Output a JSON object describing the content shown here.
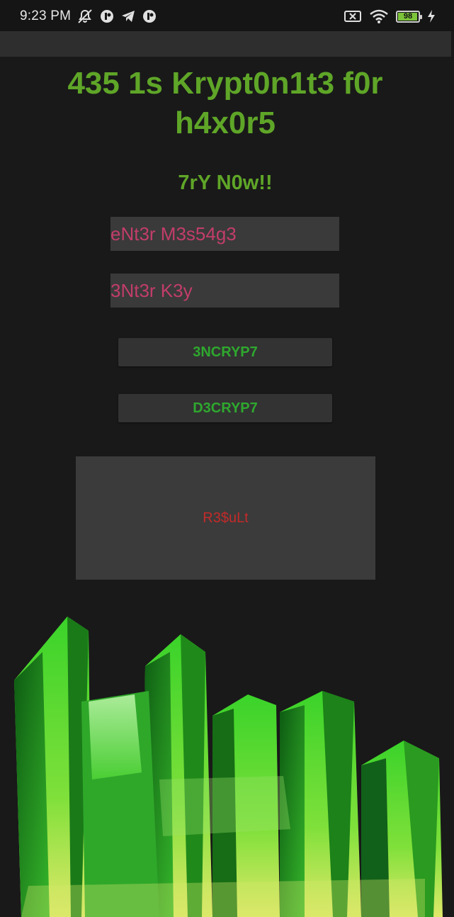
{
  "status_bar": {
    "time": "9:23 PM",
    "battery": "98",
    "icons_left": [
      "muted-notification-icon",
      "circle-app-icon",
      "telegram-icon",
      "circle-app-icon"
    ],
    "icons_right": [
      "sim-card-x-icon",
      "wifi-icon",
      "battery-icon",
      "charging-bolt-icon"
    ]
  },
  "app": {
    "title": "435 1s Krypt0n1t3 f0r h4x0r5",
    "subtitle": "7rY N0w!!"
  },
  "form": {
    "message_placeholder": "eNt3r M3s54g3",
    "key_placeholder": "3Nt3r K3y",
    "encrypt_label": "3NCRYP7",
    "decrypt_label": "D3CRYP7"
  },
  "result": {
    "placeholder": "R3$uLt"
  },
  "colors": {
    "title_green": "#5fa628",
    "button_green": "#2ea82e",
    "input_pink": "#c23d6a",
    "result_red": "#c42a2a",
    "background": "#191919"
  },
  "images": [
    "kryptonite-crystal-illustration"
  ]
}
